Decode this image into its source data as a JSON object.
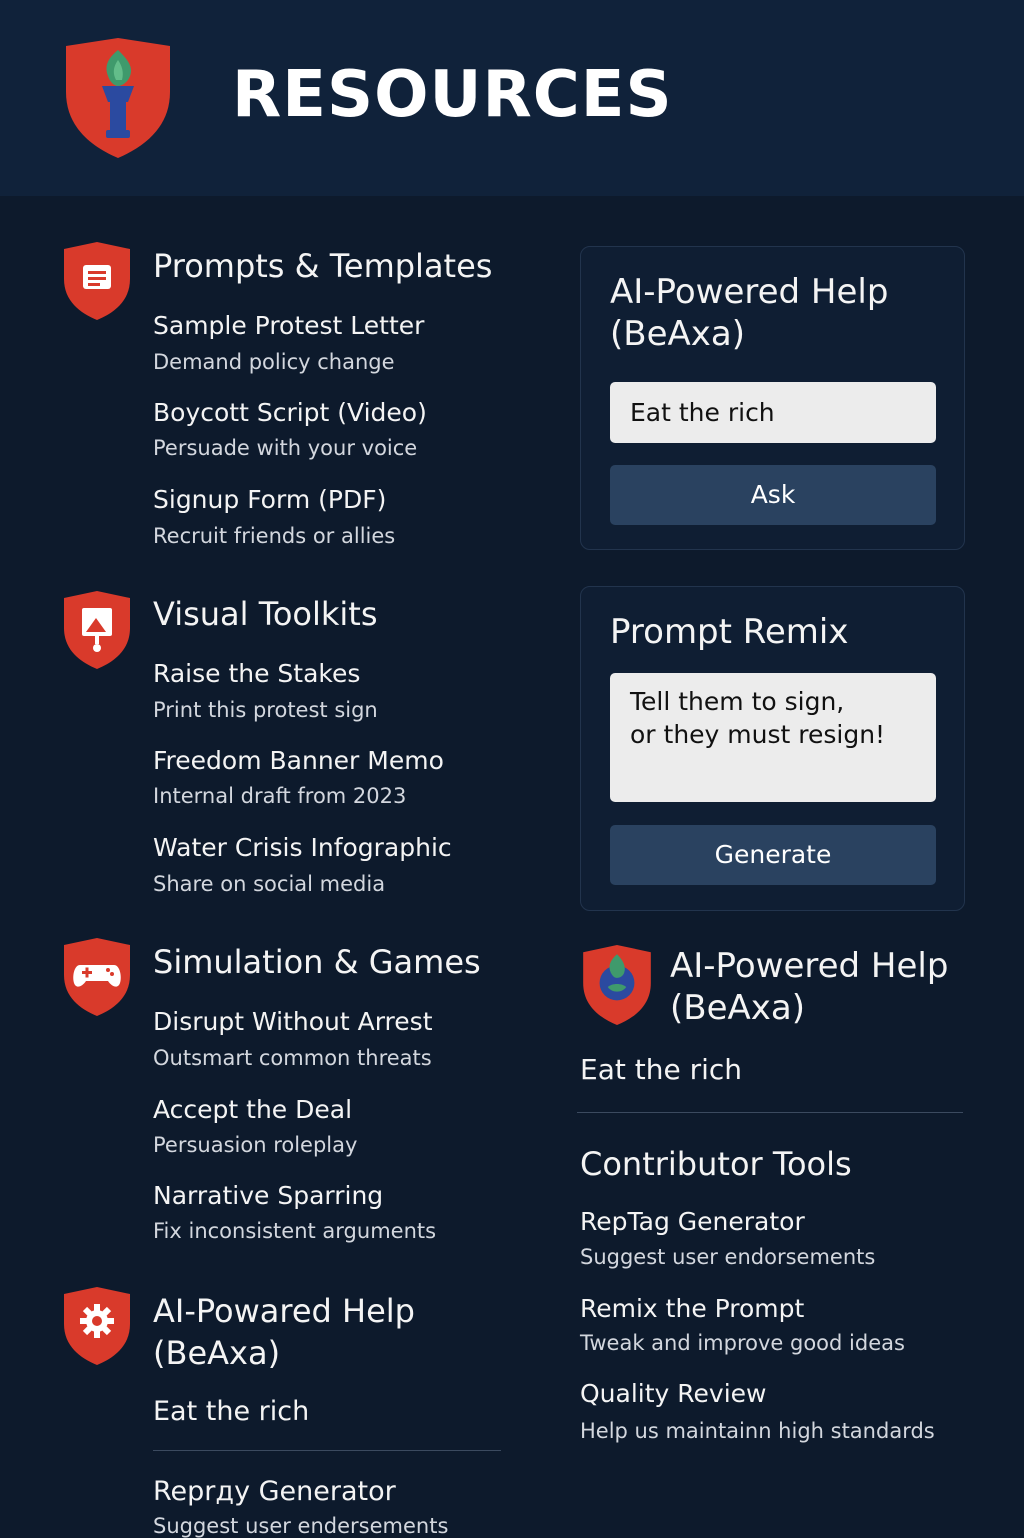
{
  "header": {
    "title": "RESOURCES",
    "logo_icon": "torch-shield-icon"
  },
  "colors": {
    "background": "#0d1a2c",
    "header": "#10223a",
    "accent": "#d93a2b",
    "button": "#2a4260",
    "input": "#ececec"
  },
  "sections": {
    "prompts": {
      "title": "Prompts & Templates",
      "icon": "document-icon",
      "items": [
        {
          "title": "Sample Protest Letter",
          "subtitle": "Demand policy change"
        },
        {
          "title": "Boycott Script (Video)",
          "subtitle": "Persuade with your voice"
        },
        {
          "title": "Signup Form (PDF)",
          "subtitle": "Recruit friends or allies"
        }
      ]
    },
    "visual": {
      "title": "Visual Toolkits",
      "icon": "sign-icon",
      "items": [
        {
          "title": "Raise the Stakes",
          "subtitle": "Print this protest sign"
        },
        {
          "title": "Freedom Banner Memo",
          "subtitle": "Internal draft from 2023"
        },
        {
          "title": "Water Crisis Infographic",
          "subtitle": "Share on social media"
        }
      ]
    },
    "games": {
      "title": "Simulation & Games",
      "icon": "gamepad-icon",
      "items": [
        {
          "title": "Disrupt Without Arrest",
          "subtitle": "Outsmart common threats"
        },
        {
          "title": "Accept the Deal",
          "subtitle": "Persuasion roleplay"
        },
        {
          "title": "Narrative Sparring",
          "subtitle": "Fix inconsistent arguments"
        }
      ]
    },
    "ai_left": {
      "title_line1": "AI-Powared Help",
      "title_line2": "(BeAxa)",
      "icon": "gear-icon",
      "text": "Eat the rich",
      "items": [
        {
          "title": "Reprдy Generator",
          "subtitle": "Suggest user endersements"
        }
      ]
    }
  },
  "ai_card": {
    "title_line1": "AI-Powered Help",
    "title_line2": "(BeAxa)",
    "input_value": "Eat the rich",
    "button": "Ask"
  },
  "remix_card": {
    "title": "Prompt Remix",
    "textarea_value": "Tell them to sign,\nor they must resign!",
    "button": "Generate"
  },
  "ai_right": {
    "title_line1": "AI-Powered Help",
    "title_line2": "(BeAxa)",
    "icon": "torch-shield-icon",
    "text": "Eat the rich"
  },
  "contributor": {
    "title": "Contributor Tools",
    "items": [
      {
        "title": "RepTag Generator",
        "subtitle": "Suggest user endorsements"
      },
      {
        "title": "Remix the Prompt",
        "subtitle": "Tweak and improve good ideas"
      },
      {
        "title": "Quality Review",
        "subtitle": "Help us maintainn high standards"
      }
    ]
  }
}
